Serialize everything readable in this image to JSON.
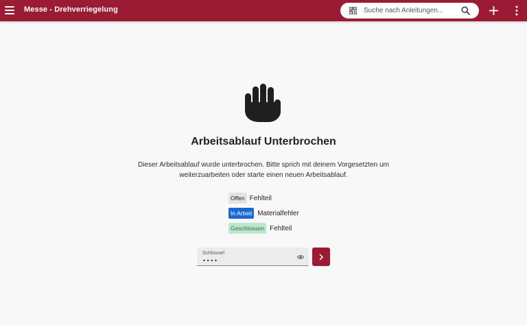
{
  "header": {
    "title": "Messe - Drehverriegelung",
    "search_placeholder": "Suche nach Anleitungen...",
    "icons": [
      "menu-icon",
      "qr-code-icon",
      "search-icon",
      "plus-icon",
      "more-vert-icon"
    ]
  },
  "main": {
    "icon": "hand-stop-icon",
    "headline": "Arbeitsablauf Unterbrochen",
    "description": "Dieser Arbeitsablauf wurde unterbrochen. Bitte sprich mit deinem Vorgesetzten um weiterzuarbeiten oder starte einen neuen Arbeitsablauf.",
    "statuses": [
      {
        "badge": "Offen",
        "label": "Fehlteil"
      },
      {
        "badge": "In Arbeit",
        "label": "Materialfehler"
      },
      {
        "badge": "Geschlossen",
        "label": "Fehlteil"
      }
    ]
  },
  "key_form": {
    "label": "Schlüssel",
    "value": "••••",
    "icons": [
      "eye-icon",
      "chevron-right-icon"
    ]
  },
  "colors": {
    "brand": "#9c1b34",
    "background": "#f8f8f8",
    "badge_offen": "#e2e2e2",
    "badge_in_arbeit": "#1a6ad6",
    "badge_geschlossen": "#bde8cf"
  }
}
